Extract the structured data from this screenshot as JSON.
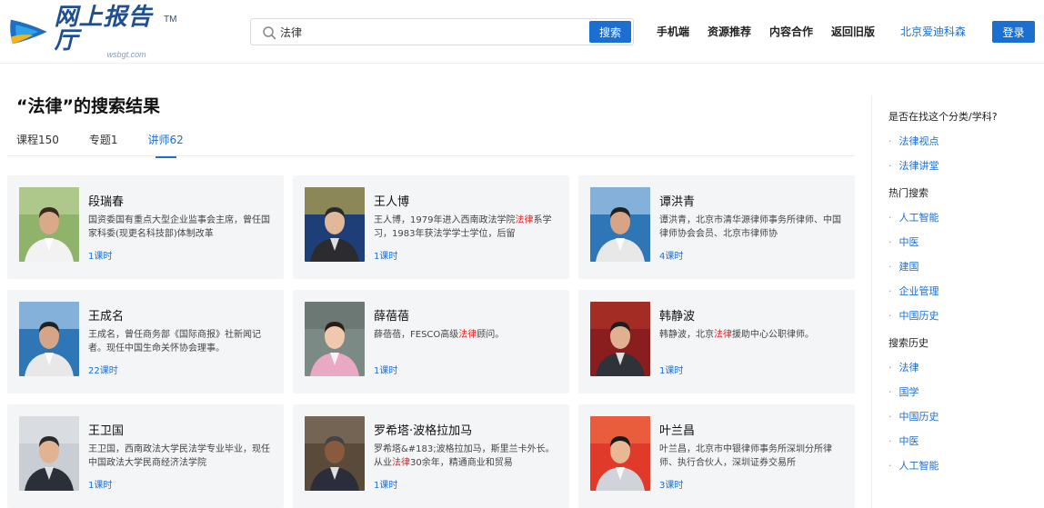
{
  "header": {
    "logo_main": "网上报告厅",
    "logo_sub": "wsbgt.com",
    "logo_tm": "TM",
    "search": {
      "value": "法律",
      "button": "搜索"
    },
    "nav": [
      "手机端",
      "资源推荐",
      "内容合作",
      "返回旧版"
    ],
    "org": "北京爱迪科森",
    "login": "登录"
  },
  "main": {
    "title": "“法律”的搜索结果",
    "tabs": [
      {
        "label": "课程150",
        "active": false
      },
      {
        "label": "专题1",
        "active": false
      },
      {
        "label": "讲师62",
        "active": true
      }
    ],
    "cards": [
      {
        "name": "段瑞春",
        "desc_parts": [
          "国资委国有重点大型企业监事会主席，曾任国家科委(现更名科技部)体制改革"
        ],
        "hl": "",
        "hours": "1课时",
        "photo": "outdoor"
      },
      {
        "name": "王人博",
        "desc_parts": [
          "王人博，1979年进入西南政法学院",
          "系学习，1983年获法学学士学位，后留"
        ],
        "hl": "法律",
        "hours": "1课时",
        "photo": "lecture-blue"
      },
      {
        "name": "谭洪青",
        "desc_parts": [
          "谭洪青，北京市清华源律师事务所律师、中国律师协会会员、北京市律师协"
        ],
        "hl": "",
        "hours": "4课时",
        "photo": "stage"
      },
      {
        "name": "王成名",
        "desc_parts": [
          "王成名，曾任商务部《国际商报》社新闻记者。现任中国生命关怀协会理事。"
        ],
        "hl": "",
        "hours": "22课时",
        "photo": "stage"
      },
      {
        "name": "薛蓓蓓",
        "desc_parts": [
          "薛蓓蓓，FESCO高级",
          "顾问。"
        ],
        "hl": "法律",
        "hours": "1课时",
        "photo": "woman"
      },
      {
        "name": "韩静波",
        "desc_parts": [
          "韩静波，北京",
          "援助中心公职律师。"
        ],
        "hl": "法律",
        "hours": "1课时",
        "photo": "portrait-red"
      },
      {
        "name": "王卫国",
        "desc_parts": [
          "王卫国，西南政法大学民法学专业毕业，现任中国政法大学民商经济法学院"
        ],
        "hl": "",
        "hours": "1课时",
        "photo": "portrait-grey"
      },
      {
        "name": "罗希塔·波格拉加马",
        "desc_parts": [
          "罗希塔&#183;波格拉加马，斯里兰卡外长。从业",
          "30余年，精通商业和贸易"
        ],
        "hl": "法律",
        "hours": "1课时",
        "photo": "portrait-dark"
      },
      {
        "name": "叶兰昌",
        "desc_parts": [
          "叶兰昌，北京市中银律师事务所深圳分所律师、执行合伙人，深圳证券交易所"
        ],
        "hl": "",
        "hours": "3课时",
        "photo": "portrait-bright"
      }
    ]
  },
  "sidebar": {
    "sections": [
      {
        "title": "是否在找这个分类/学科?",
        "items": [
          "法律视点",
          "法律讲堂"
        ]
      },
      {
        "title": "热门搜索",
        "items": [
          "人工智能",
          "中医",
          "建国",
          "企业管理",
          "中国历史"
        ]
      },
      {
        "title": "搜索历史",
        "items": [
          "法律",
          "国学",
          "中国历史",
          "中医",
          "人工智能"
        ]
      }
    ]
  },
  "colors": {
    "accent": "#1a6fd1",
    "highlight": "#e02020",
    "card_bg": "#f4f5f7"
  }
}
